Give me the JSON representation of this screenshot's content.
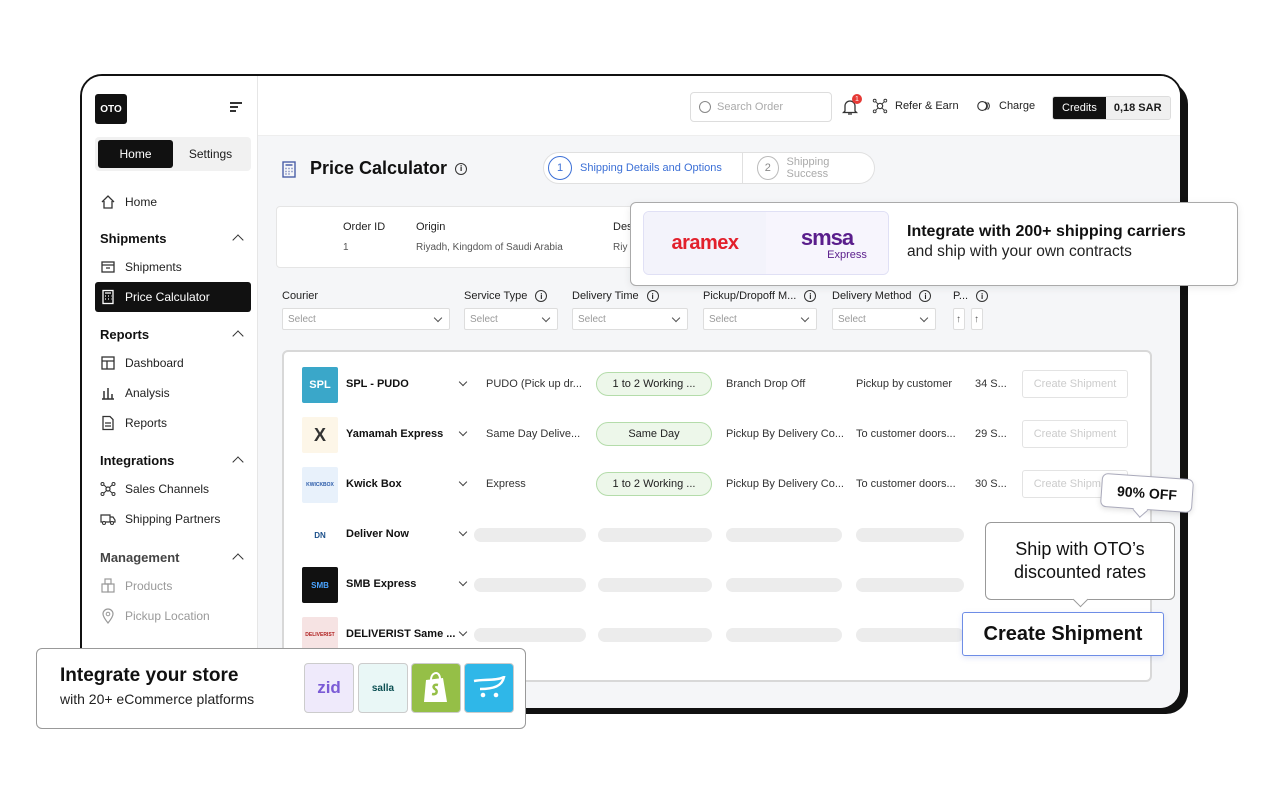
{
  "app": {
    "logo": "OTO"
  },
  "sidebar": {
    "tabs": [
      {
        "label": "Home"
      },
      {
        "label": "Settings"
      }
    ],
    "home": "Home",
    "sections": [
      {
        "title": "Shipments",
        "items": [
          "Shipments",
          "Price Calculator"
        ]
      },
      {
        "title": "Reports",
        "items": [
          "Dashboard",
          "Analysis",
          "Reports"
        ]
      },
      {
        "title": "Integrations",
        "items": [
          "Sales Channels",
          "Shipping Partners"
        ]
      },
      {
        "title": "Management",
        "items": [
          "Products",
          "Pickup Location"
        ]
      }
    ]
  },
  "topbar": {
    "search_placeholder": "Search Order",
    "notification_count": "1",
    "refer": "Refer & Earn",
    "charge": "Charge",
    "credits_label": "Credits",
    "credits_value": "0,18 SAR"
  },
  "page": {
    "title": "Price Calculator",
    "steps": [
      {
        "num": "1",
        "label": "Shipping Details and Options"
      },
      {
        "num": "2",
        "label": "Shipping Success"
      }
    ],
    "order": {
      "id_label": "Order ID",
      "id_value": "1",
      "origin_label": "Origin",
      "origin_value": "Riyadh, Kingdom of Saudi Arabia",
      "dest_label": "Des",
      "dest_value": "Riy"
    },
    "filters": [
      {
        "label": "Courier",
        "value": "Select"
      },
      {
        "label": "Service Type",
        "value": "Select"
      },
      {
        "label": "Delivery Time",
        "value": "Select"
      },
      {
        "label": "Pickup/Dropoff M...",
        "value": "Select"
      },
      {
        "label": "Delivery Method",
        "value": "Select"
      },
      {
        "label": "P...",
        "value": "↑"
      }
    ]
  },
  "couriers": [
    {
      "name": "SPL - PUDO",
      "logo_text": "SPL",
      "service": "PUDO (Pick up dr...",
      "time": "1 to 2 Working ...",
      "pickup": "Branch Drop Off",
      "method": "Pickup by customer",
      "price": "34 S...",
      "action": "Create Shipment",
      "logo_bg": "#3aa7c9",
      "logo_color": "#ffffff"
    },
    {
      "name": "Yamamah Express",
      "logo_text": "X",
      "service": "Same Day Delive...",
      "time": "Same Day",
      "pickup": "Pickup By Delivery Co...",
      "method": "To customer doors...",
      "price": "29 S...",
      "action": "Create Shipment",
      "logo_bg": "#fdf6e8",
      "logo_color": "#333333"
    },
    {
      "name": "Kwick Box",
      "logo_text": "KWICKBOX",
      "service": "Express",
      "time": "1 to 2 Working ...",
      "pickup": "Pickup By Delivery Co...",
      "method": "To customer doors...",
      "price": "30 S...",
      "action": "Create Shipment",
      "logo_bg": "#e8f1fb",
      "logo_color": "#2a5aa8"
    },
    {
      "name": "Deliver Now",
      "logo_text": "DN",
      "logo_bg": "#ffffff",
      "logo_color": "#1b4f8a"
    },
    {
      "name": "SMB Express",
      "logo_text": "SMB",
      "logo_bg": "#111111",
      "logo_color": "#4aa3ff"
    },
    {
      "name": "DELIVERIST Same ...",
      "logo_text": "DELIVERIST",
      "logo_bg": "#f6e3e3",
      "logo_color": "#b02020"
    }
  ],
  "promos": {
    "carriers_title": "Integrate with 200+ shipping carriers",
    "carriers_sub": "and ship with your own contracts",
    "aramex": "aramex",
    "smsa": "smsa",
    "smsa_sub": "Express",
    "store_title": "Integrate your store",
    "store_sub": "with 20+ eCommerce platforms",
    "zid": "zid",
    "salla": "salla",
    "discount": "90% OFF",
    "discount_tip": "Ship with OTO’s discounted rates",
    "create_button": "Create Shipment"
  }
}
